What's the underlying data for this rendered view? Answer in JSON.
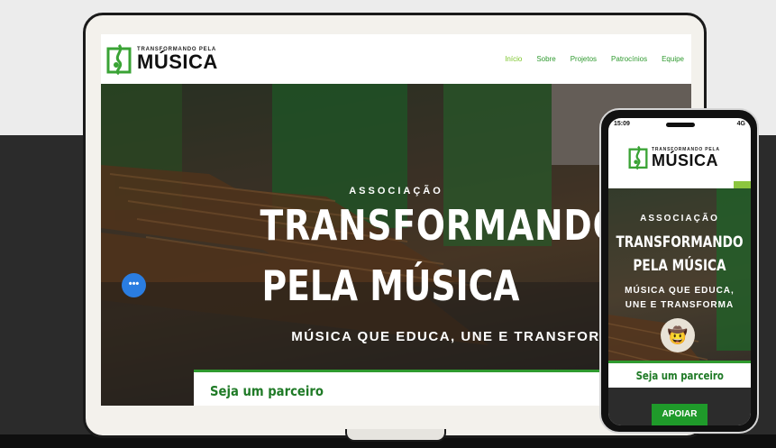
{
  "desktop": {
    "logo": {
      "top_line": "TRANSFORMANDO PELA",
      "main": "MÚSICA"
    },
    "nav": [
      "Início",
      "Sobre",
      "Projetos",
      "Patrocínios",
      "Equipe"
    ],
    "hero": {
      "kicker": "ASSOCIAÇÃO",
      "title_line1": "TRANSFORMANDO",
      "title_line2": "PELA MÚSICA",
      "subtitle": "MÚSICA QUE EDUCA, UNE E TRANSFOR"
    },
    "partner_cta": "Seja um parceiro"
  },
  "mobile": {
    "status_time": "15:09",
    "status_signal": "4G",
    "logo": {
      "top_line": "TRANSFORMANDO PELA",
      "main": "MÚSICA"
    },
    "hero": {
      "kicker": "ASSOCIAÇÃO",
      "title_line1": "TRANSFORMANDO",
      "title_line2": "PELA MÚSICA",
      "subtitle_line1": "MÚSICA QUE EDUCA,",
      "subtitle_line2": "UNE E TRANSFORMA"
    },
    "emoji": "🤠",
    "partner_cta": "Seja um parceiro",
    "support_button": "APOIAR",
    "chat_icon": "•••"
  },
  "colors": {
    "brand_green": "#2f9a2f",
    "nav_active": "#7cc62c",
    "cta_green": "#1f9a2a",
    "chat_blue": "#2a7de1"
  },
  "icons": [
    "logo-mark-icon",
    "hamburger-menu-icon",
    "chat-icon",
    "avatar-emoji-icon"
  ]
}
